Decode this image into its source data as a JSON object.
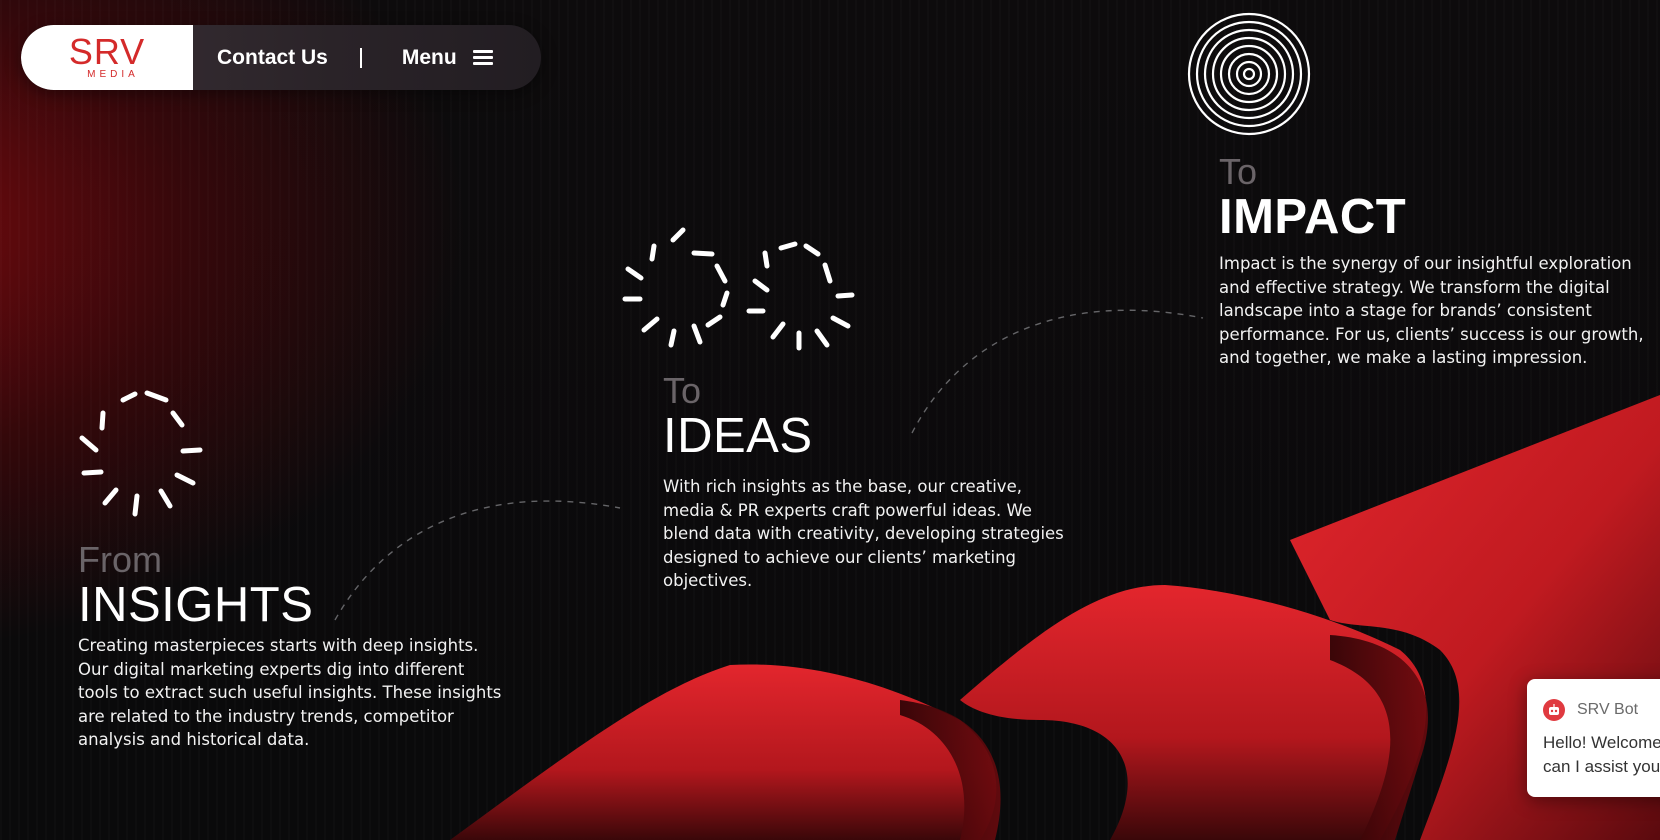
{
  "header": {
    "logo_text": "SRV",
    "logo_sub": "MEDIA",
    "contact_label": "Contact Us",
    "menu_label": "Menu"
  },
  "sections": {
    "insights": {
      "prefix": "From",
      "title": "INSIGHTS",
      "body": "Creating masterpieces starts with deep insights. Our digital marketing experts dig into different tools to extract such useful insights. These insights are related to the industry trends, competitor analysis and historical data."
    },
    "ideas": {
      "prefix": "To",
      "title": "IDEAS",
      "body": "With rich insights as the base, our creative, media & PR experts craft powerful ideas. We blend data with creativity, developing strategies designed to achieve our clients’ marketing objectives."
    },
    "impact": {
      "prefix": "To",
      "title": "IMPACT",
      "body": "Impact is the synergy of our insightful exploration and effective strategy. We transform the digital landscape into a stage for brands’ consistent performance. For us, clients’ success is our growth, and together, we make a lasting impression."
    }
  },
  "chatbot": {
    "name": "SRV Bot",
    "message_line1": "Hello! Welcome",
    "message_line2": "can I assist you"
  },
  "colors": {
    "brand_red": "#d42a2a",
    "ribbon_red": "#d91f26",
    "background": "#0b0b0c",
    "muted_text": "#6a6468"
  },
  "icons": {
    "insights": "burst-circle-icon",
    "ideas": "double-burst-icon",
    "impact": "concentric-circles-icon",
    "menu": "hamburger-icon",
    "bot": "bot-icon"
  }
}
